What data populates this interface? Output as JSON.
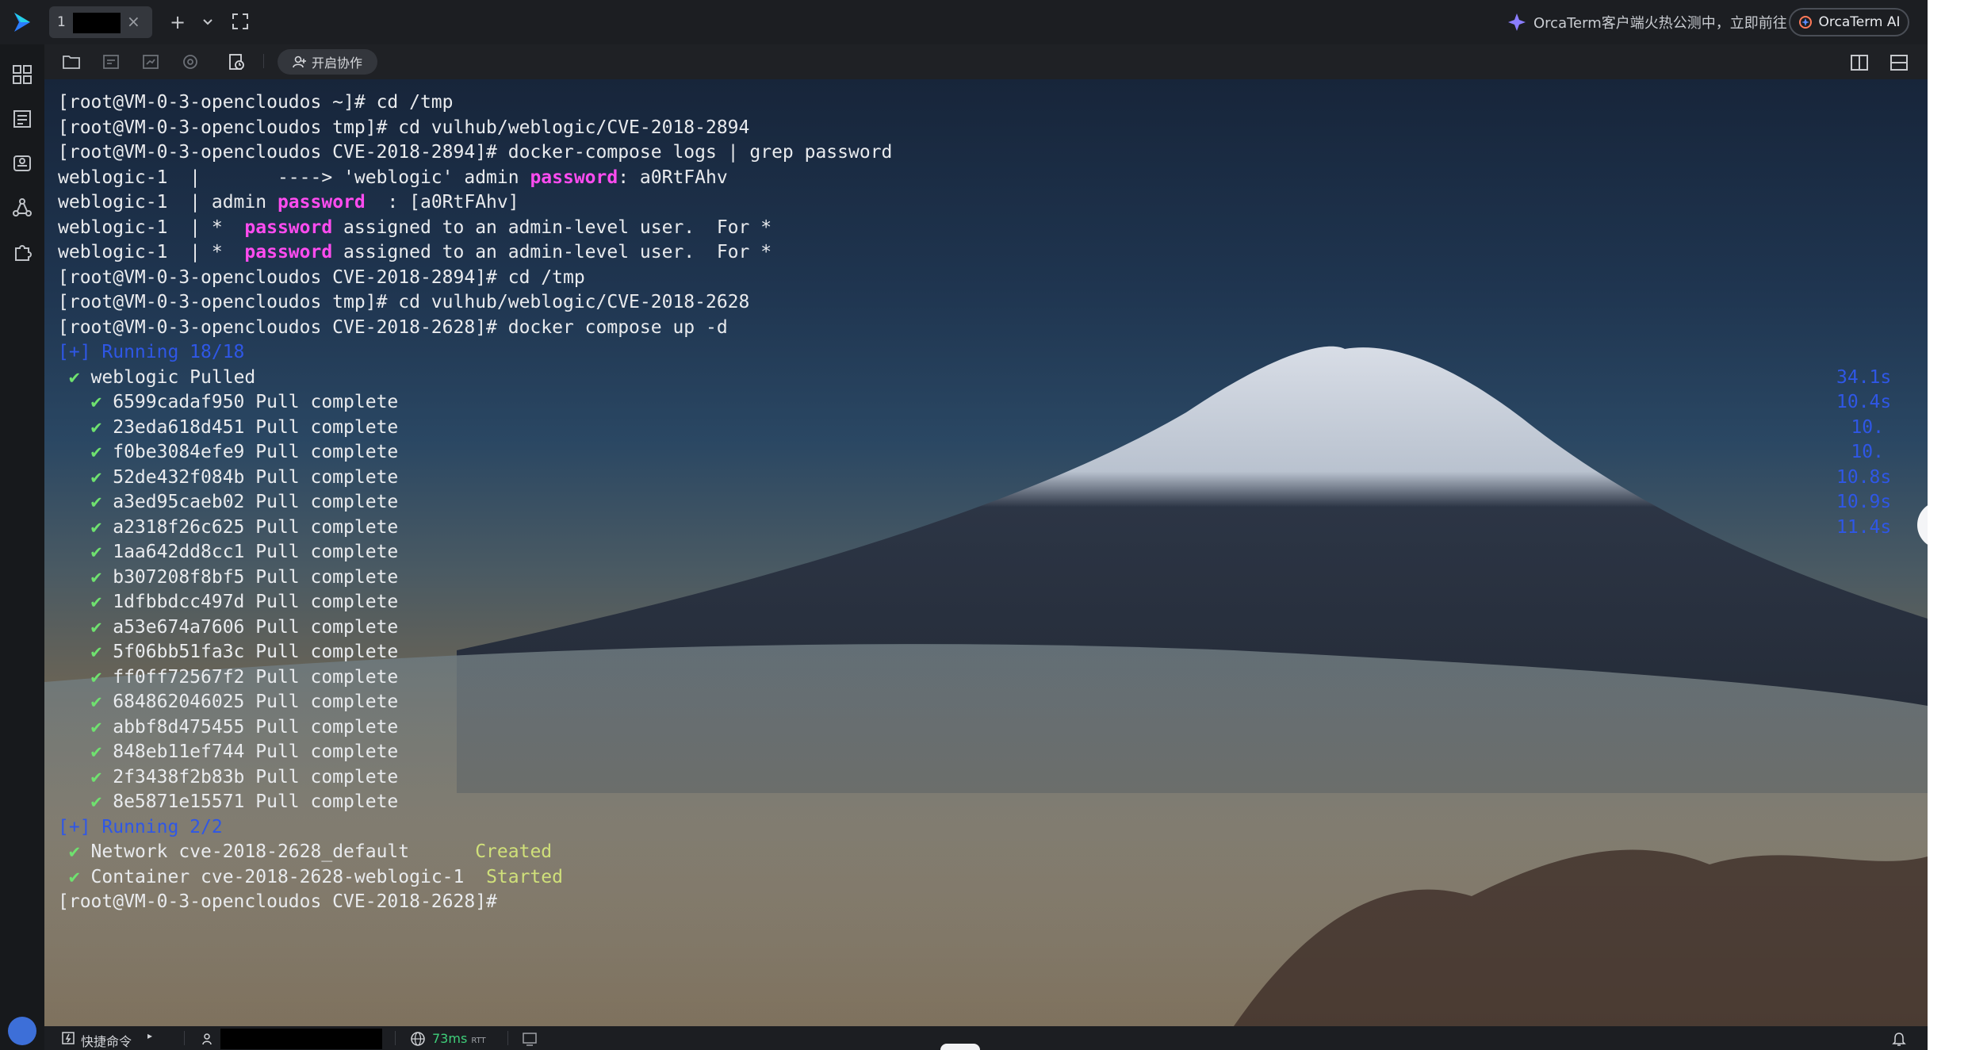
{
  "app": {
    "tab": {
      "number": "1"
    },
    "promo": {
      "text": "OrcaTerm客户端火热公测中，立即前往"
    },
    "ai_button": {
      "label": "OrcaTerm AI"
    },
    "toolbar": {
      "collab_label": "开启协作"
    },
    "colors": {
      "accent_magenta": "#ff4cf0",
      "compose_blue": "#2f57e6",
      "check_green": "#6fe26f",
      "ping_green": "#3fcf7a"
    }
  },
  "terminal": {
    "lines": [
      {
        "parts": [
          {
            "t": "[root@VM-0-3-opencloudos ~]# cd /tmp"
          }
        ]
      },
      {
        "parts": [
          {
            "t": "[root@VM-0-3-opencloudos tmp]# cd vulhub/weblogic/CVE-2018-2894"
          }
        ]
      },
      {
        "parts": [
          {
            "t": "[root@VM-0-3-opencloudos CVE-2018-2894]# docker-compose logs | grep password"
          }
        ]
      },
      {
        "parts": [
          {
            "t": "weblogic-1  |       ----> 'weblogic' admin "
          },
          {
            "t": "password",
            "c": "hl"
          },
          {
            "t": ": a0RtFAhv"
          }
        ]
      },
      {
        "parts": [
          {
            "t": "weblogic-1  | admin "
          },
          {
            "t": "password",
            "c": "hl"
          },
          {
            "t": "  : [a0RtFAhv]"
          }
        ]
      },
      {
        "parts": [
          {
            "t": "weblogic-1  | *  "
          },
          {
            "t": "password",
            "c": "hl"
          },
          {
            "t": " assigned to an admin-level user.  For *"
          }
        ]
      },
      {
        "parts": [
          {
            "t": "weblogic-1  | *  "
          },
          {
            "t": "password",
            "c": "hl"
          },
          {
            "t": " assigned to an admin-level user.  For *"
          }
        ]
      },
      {
        "parts": [
          {
            "t": "[root@VM-0-3-opencloudos CVE-2018-2894]# cd /tmp"
          }
        ]
      },
      {
        "parts": [
          {
            "t": "[root@VM-0-3-opencloudos tmp]# cd vulhub/weblogic/CVE-2018-2628"
          }
        ]
      },
      {
        "parts": [
          {
            "t": "[root@VM-0-3-opencloudos CVE-2018-2628]# docker compose up -d"
          }
        ]
      },
      {
        "parts": [
          {
            "t": "[+] Running 18/18",
            "c": "blue"
          }
        ]
      },
      {
        "parts": [
          {
            "t": " ✔",
            "c": "green"
          },
          {
            "t": " weblogic Pulled"
          }
        ]
      },
      {
        "parts": [
          {
            "t": "   ✔",
            "c": "green"
          },
          {
            "t": " 6599cadaf950 Pull complete"
          }
        ]
      },
      {
        "parts": [
          {
            "t": "   ✔",
            "c": "green"
          },
          {
            "t": " 23eda618d451 Pull complete"
          }
        ]
      },
      {
        "parts": [
          {
            "t": "   ✔",
            "c": "green"
          },
          {
            "t": " f0be3084efe9 Pull complete"
          }
        ]
      },
      {
        "parts": [
          {
            "t": "   ✔",
            "c": "green"
          },
          {
            "t": " 52de432f084b Pull complete"
          }
        ]
      },
      {
        "parts": [
          {
            "t": "   ✔",
            "c": "green"
          },
          {
            "t": " a3ed95caeb02 Pull complete"
          }
        ]
      },
      {
        "parts": [
          {
            "t": "   ✔",
            "c": "green"
          },
          {
            "t": " a2318f26c625 Pull complete"
          }
        ]
      },
      {
        "parts": [
          {
            "t": "   ✔",
            "c": "green"
          },
          {
            "t": " 1aa642dd8cc1 Pull complete"
          }
        ]
      },
      {
        "parts": [
          {
            "t": "   ✔",
            "c": "green"
          },
          {
            "t": " b307208f8bf5 Pull complete"
          }
        ]
      },
      {
        "parts": [
          {
            "t": "   ✔",
            "c": "green"
          },
          {
            "t": " 1dfbbdcc497d Pull complete"
          }
        ]
      },
      {
        "parts": [
          {
            "t": "   ✔",
            "c": "green"
          },
          {
            "t": " a53e674a7606 Pull complete"
          }
        ]
      },
      {
        "parts": [
          {
            "t": "   ✔",
            "c": "green"
          },
          {
            "t": " 5f06bb51fa3c Pull complete"
          }
        ]
      },
      {
        "parts": [
          {
            "t": "   ✔",
            "c": "green"
          },
          {
            "t": " ff0ff72567f2 Pull complete"
          }
        ]
      },
      {
        "parts": [
          {
            "t": "   ✔",
            "c": "green"
          },
          {
            "t": " 684862046025 Pull complete"
          }
        ]
      },
      {
        "parts": [
          {
            "t": "   ✔",
            "c": "green"
          },
          {
            "t": " abbf8d475455 Pull complete"
          }
        ]
      },
      {
        "parts": [
          {
            "t": "   ✔",
            "c": "green"
          },
          {
            "t": " 848eb11ef744 Pull complete"
          }
        ]
      },
      {
        "parts": [
          {
            "t": "   ✔",
            "c": "green"
          },
          {
            "t": " 2f3438f2b83b Pull complete"
          }
        ]
      },
      {
        "parts": [
          {
            "t": "   ✔",
            "c": "green"
          },
          {
            "t": " 8e5871e15571 Pull complete"
          }
        ]
      },
      {
        "parts": [
          {
            "t": "[+] Running 2/2",
            "c": "blue"
          }
        ]
      },
      {
        "parts": [
          {
            "t": " ✔",
            "c": "green"
          },
          {
            "t": " Network cve-2018-2628_default      "
          },
          {
            "t": "Created",
            "c": "cstat"
          }
        ]
      },
      {
        "parts": [
          {
            "t": " ✔",
            "c": "green"
          },
          {
            "t": " Container cve-2018-2628-weblogic-1  "
          },
          {
            "t": "Started",
            "c": "cstat"
          }
        ]
      },
      {
        "parts": [
          {
            "t": "[root@VM-0-3-opencloudos CVE-2018-2628]# "
          }
        ]
      }
    ],
    "times": [
      "",
      "",
      "",
      "",
      "",
      "",
      "",
      "",
      "",
      "",
      "",
      "34.1s",
      "10.4s",
      "10.",
      "10.",
      "10.8s",
      "10.9s",
      "11.4s"
    ]
  },
  "statusbar": {
    "quick_cmd": "快捷命令",
    "ping": "73ms",
    "rtt": "RTT"
  }
}
